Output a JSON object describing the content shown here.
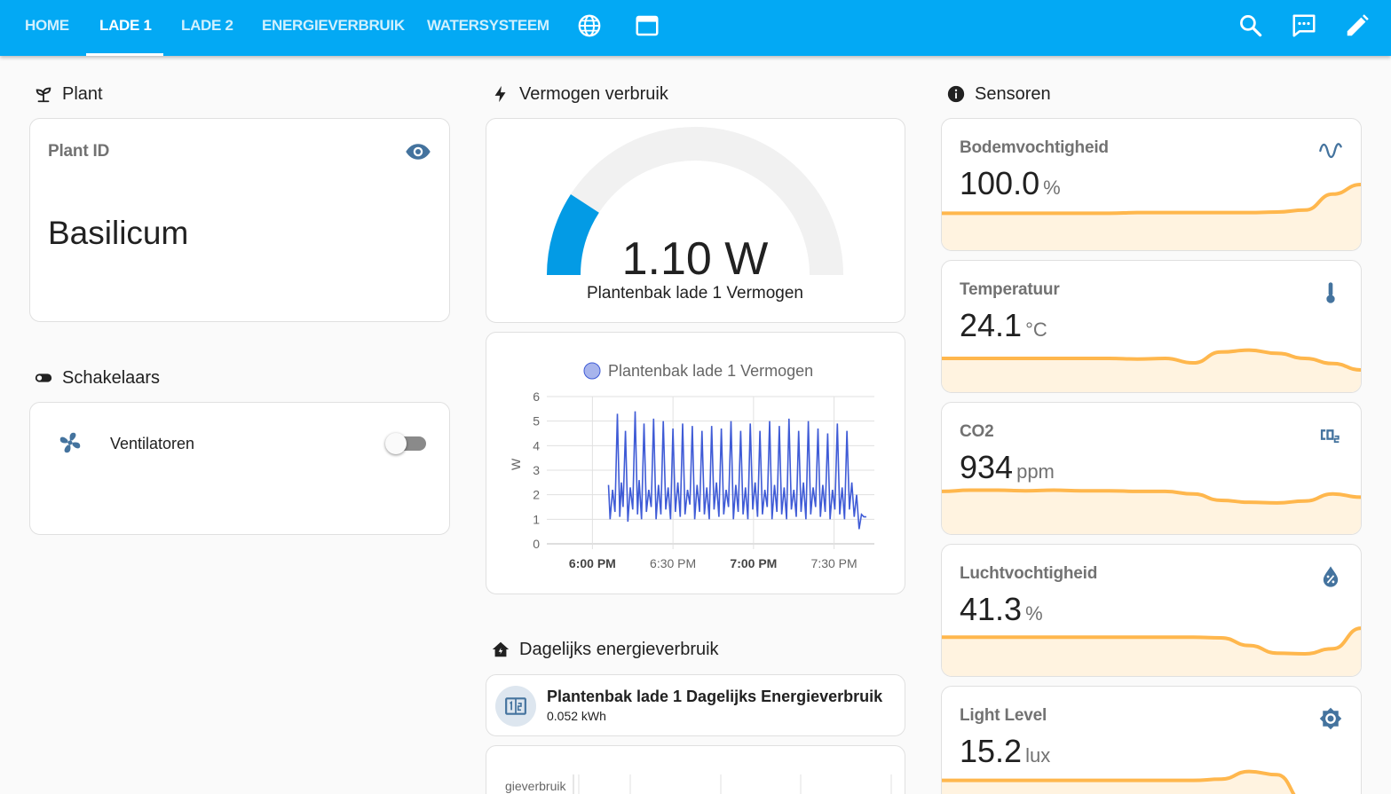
{
  "topbar": {
    "tabs": [
      "HOME",
      "LADE 1",
      "LADE 2",
      "ENERGIEVERBRUIK",
      "WATERSYSTEEM"
    ],
    "active_tab": "LADE 1",
    "icons": [
      "globe-icon",
      "window-icon",
      "search-icon",
      "assist-icon",
      "edit-icon"
    ]
  },
  "plant": {
    "header": "Plant",
    "label": "Plant ID",
    "value": "Basilicum"
  },
  "switches": {
    "header": "Schakelaars",
    "items": [
      {
        "label": "Ventilatoren",
        "on": false
      }
    ]
  },
  "power": {
    "header": "Vermogen verbruik",
    "gauge": {
      "value": "1.10 W",
      "name": "Plantenbak lade 1 Vermogen",
      "min": 0,
      "max": 6,
      "level": 1.1
    }
  },
  "chart_data": {
    "type": "line",
    "legend": [
      "Plantenbak lade 1 Vermogen"
    ],
    "ylabel": "W",
    "ylim": [
      0,
      6
    ],
    "yticks": [
      "0",
      "1",
      "2",
      "3",
      "4",
      "5",
      "6"
    ],
    "xticks": [
      "6:00 PM",
      "6:30 PM",
      "7:00 PM",
      "7:30 PM"
    ],
    "xlim": [
      17.75,
      19.75
    ],
    "series": [
      {
        "name": "Plantenbak lade 1 Vermogen",
        "x": [
          18.1,
          18.11,
          18.125,
          18.14,
          18.155,
          18.17,
          18.18,
          18.19,
          18.205,
          18.22,
          18.235,
          18.25,
          18.265,
          18.28,
          18.29,
          18.305,
          18.32,
          18.335,
          18.35,
          18.365,
          18.38,
          18.395,
          18.41,
          18.425,
          18.44,
          18.455,
          18.47,
          18.485,
          18.5,
          18.515,
          18.53,
          18.545,
          18.56,
          18.575,
          18.59,
          18.605,
          18.62,
          18.635,
          18.65,
          18.665,
          18.68,
          18.695,
          18.71,
          18.725,
          18.74,
          18.755,
          18.77,
          18.785,
          18.8,
          18.815,
          18.83,
          18.845,
          18.86,
          18.875,
          18.89,
          18.905,
          18.92,
          18.935,
          18.95,
          18.965,
          18.98,
          18.995,
          19.01,
          19.025,
          19.04,
          19.055,
          19.07,
          19.085,
          19.1,
          19.115,
          19.13,
          19.145,
          19.16,
          19.175,
          19.19,
          19.205,
          19.22,
          19.235,
          19.25,
          19.265,
          19.28,
          19.295,
          19.31,
          19.325,
          19.34,
          19.355,
          19.37,
          19.385,
          19.4,
          19.415,
          19.43,
          19.445,
          19.46,
          19.475,
          19.49,
          19.505,
          19.52,
          19.535,
          19.55,
          19.565,
          19.58,
          19.595,
          19.61,
          19.625,
          19.64,
          19.655,
          19.67,
          19.685,
          19.7
        ],
        "values": [
          2.4,
          1.0,
          2.2,
          1.3,
          5.3,
          1.1,
          2.5,
          1.5,
          4.6,
          0.9,
          2.3,
          1.4,
          5.4,
          1.2,
          2.6,
          1.0,
          4.9,
          1.3,
          2.2,
          1.5,
          5.1,
          1.0,
          2.4,
          1.2,
          5.0,
          1.4,
          2.3,
          1.0,
          4.7,
          1.3,
          2.5,
          1.1,
          4.9,
          1.2,
          2.2,
          1.6,
          4.8,
          1.0,
          2.4,
          1.3,
          4.6,
          1.2,
          2.3,
          1.0,
          4.8,
          1.4,
          2.5,
          1.1,
          4.7,
          1.2,
          2.2,
          1.5,
          5.0,
          1.0,
          2.4,
          1.3,
          4.6,
          1.2,
          2.3,
          1.0,
          4.9,
          1.4,
          2.5,
          1.1,
          4.6,
          1.2,
          2.2,
          1.5,
          5.0,
          1.0,
          2.4,
          1.3,
          4.8,
          1.2,
          2.3,
          1.0,
          5.1,
          1.4,
          2.2,
          1.1,
          4.6,
          1.3,
          2.5,
          1.0,
          5.0,
          1.2,
          2.3,
          1.5,
          4.7,
          1.1,
          2.4,
          1.3,
          4.5,
          1.0,
          2.2,
          1.4,
          4.9,
          1.2,
          2.3,
          1.0,
          4.6,
          1.4,
          2.5,
          1.1,
          2.0,
          0.6,
          1.2,
          1.1,
          1.1
        ],
        "color": "#3f5bd6"
      }
    ],
    "grid": true,
    "legend_placement": "top-center"
  },
  "daily": {
    "header": "Dagelijks energieverbruik",
    "entity_name": "Plantenbak lade 1 Dagelijks Energieverbruik",
    "entity_state": "0.052 kWh",
    "partial_label": "gieverbruik"
  },
  "sensors": {
    "header": "Sensoren",
    "items": [
      {
        "name": "Bodemvochtigheid",
        "value": "100.0",
        "unit": "%",
        "icon": "sine-wave-icon",
        "trend": [
          0.55,
          0.55,
          0.55,
          0.55,
          0.55,
          0.55,
          0.55,
          0.56,
          0.56,
          0.56,
          0.56,
          0.56,
          0.57,
          0.6,
          0.85,
          1.0
        ]
      },
      {
        "name": "Temperatuur",
        "value": "24.1",
        "unit": "°C",
        "icon": "thermometer-icon",
        "trend": [
          0.5,
          0.5,
          0.5,
          0.5,
          0.5,
          0.5,
          0.5,
          0.49,
          0.5,
          0.43,
          0.6,
          0.63,
          0.58,
          0.5,
          0.42,
          0.32
        ]
      },
      {
        "name": "CO2",
        "value": "934",
        "unit": "ppm",
        "icon": "co2-icon",
        "trend": [
          0.64,
          0.66,
          0.66,
          0.65,
          0.66,
          0.65,
          0.65,
          0.64,
          0.64,
          0.6,
          0.5,
          0.47,
          0.46,
          0.49,
          0.6,
          0.55
        ]
      },
      {
        "name": "Luchtvochtigheid",
        "value": "41.3",
        "unit": "%",
        "icon": "water-percent-icon",
        "trend": [
          0.58,
          0.58,
          0.58,
          0.58,
          0.58,
          0.58,
          0.58,
          0.58,
          0.58,
          0.58,
          0.57,
          0.45,
          0.33,
          0.32,
          0.4,
          0.72
        ]
      },
      {
        "name": "Light Level",
        "value": "15.2",
        "unit": "lux",
        "icon": "sun-icon",
        "trend": [
          0.56,
          0.56,
          0.56,
          0.56,
          0.56,
          0.56,
          0.56,
          0.56,
          0.56,
          0.56,
          0.58,
          0.7,
          0.65,
          0.2,
          0.0,
          0.0
        ]
      }
    ]
  },
  "colors": {
    "header_bg": "#03a9f4",
    "gauge_fill": "#039be5",
    "gauge_track": "#f1f1f1",
    "icon": "#44739e",
    "spark_line": "#ffb74d",
    "spark_fill": "#fff3e0",
    "chart_line": "#3f5bd6"
  }
}
